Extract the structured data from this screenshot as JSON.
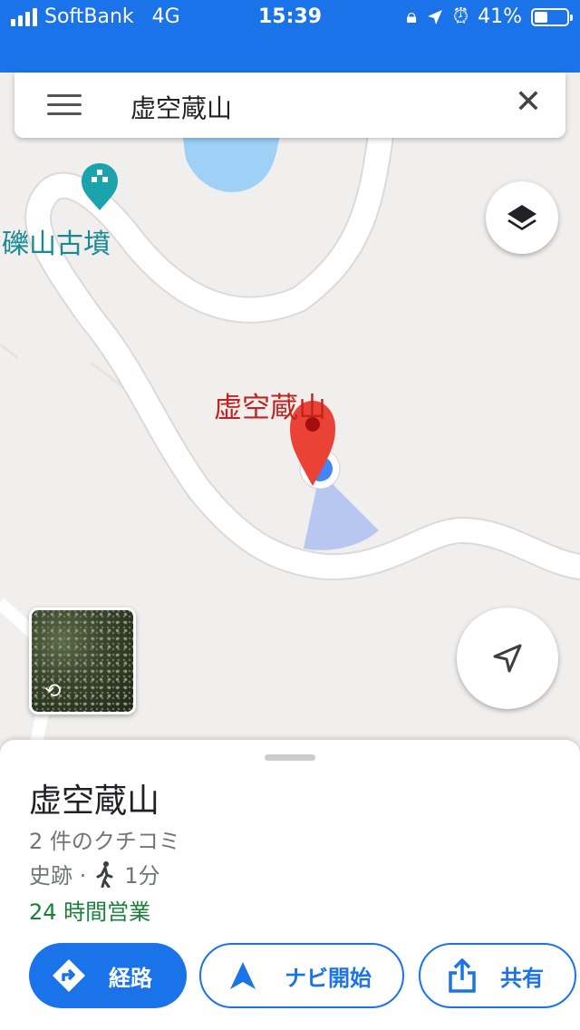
{
  "status_bar": {
    "carrier": "SoftBank",
    "network": "4G",
    "time": "15:39",
    "battery": "41%",
    "battery_level": 0.41,
    "icons": [
      "signal-icon",
      "rotation-lock-icon",
      "location-arrow-icon",
      "alarm-icon",
      "battery-icon"
    ]
  },
  "search": {
    "query": "虚空蔵山",
    "menu_icon": "menu-icon",
    "clear_icon": "close-icon"
  },
  "map": {
    "poi_label": "礫山古墳",
    "place_label": "虚空蔵山",
    "layers_icon": "layers-icon",
    "locate_icon": "navigation-arrow-icon",
    "street_view_icon": "rotate-360-icon",
    "colors": {
      "background": "#f1efee",
      "road": "#ffffff",
      "water": "#9fd0f5",
      "poi": "#178a94",
      "pin": "#ea4335"
    }
  },
  "place_sheet": {
    "title": "虚空蔵山",
    "reviews": "2 件のクチコミ",
    "category": "史跡 ·",
    "walk_time": "1分",
    "hours": "24 時間営業",
    "buttons": {
      "route": "経路",
      "navigate": "ナビ開始",
      "share": "共有"
    }
  },
  "colors": {
    "accent": "#1a73e8",
    "open": "#188038"
  }
}
